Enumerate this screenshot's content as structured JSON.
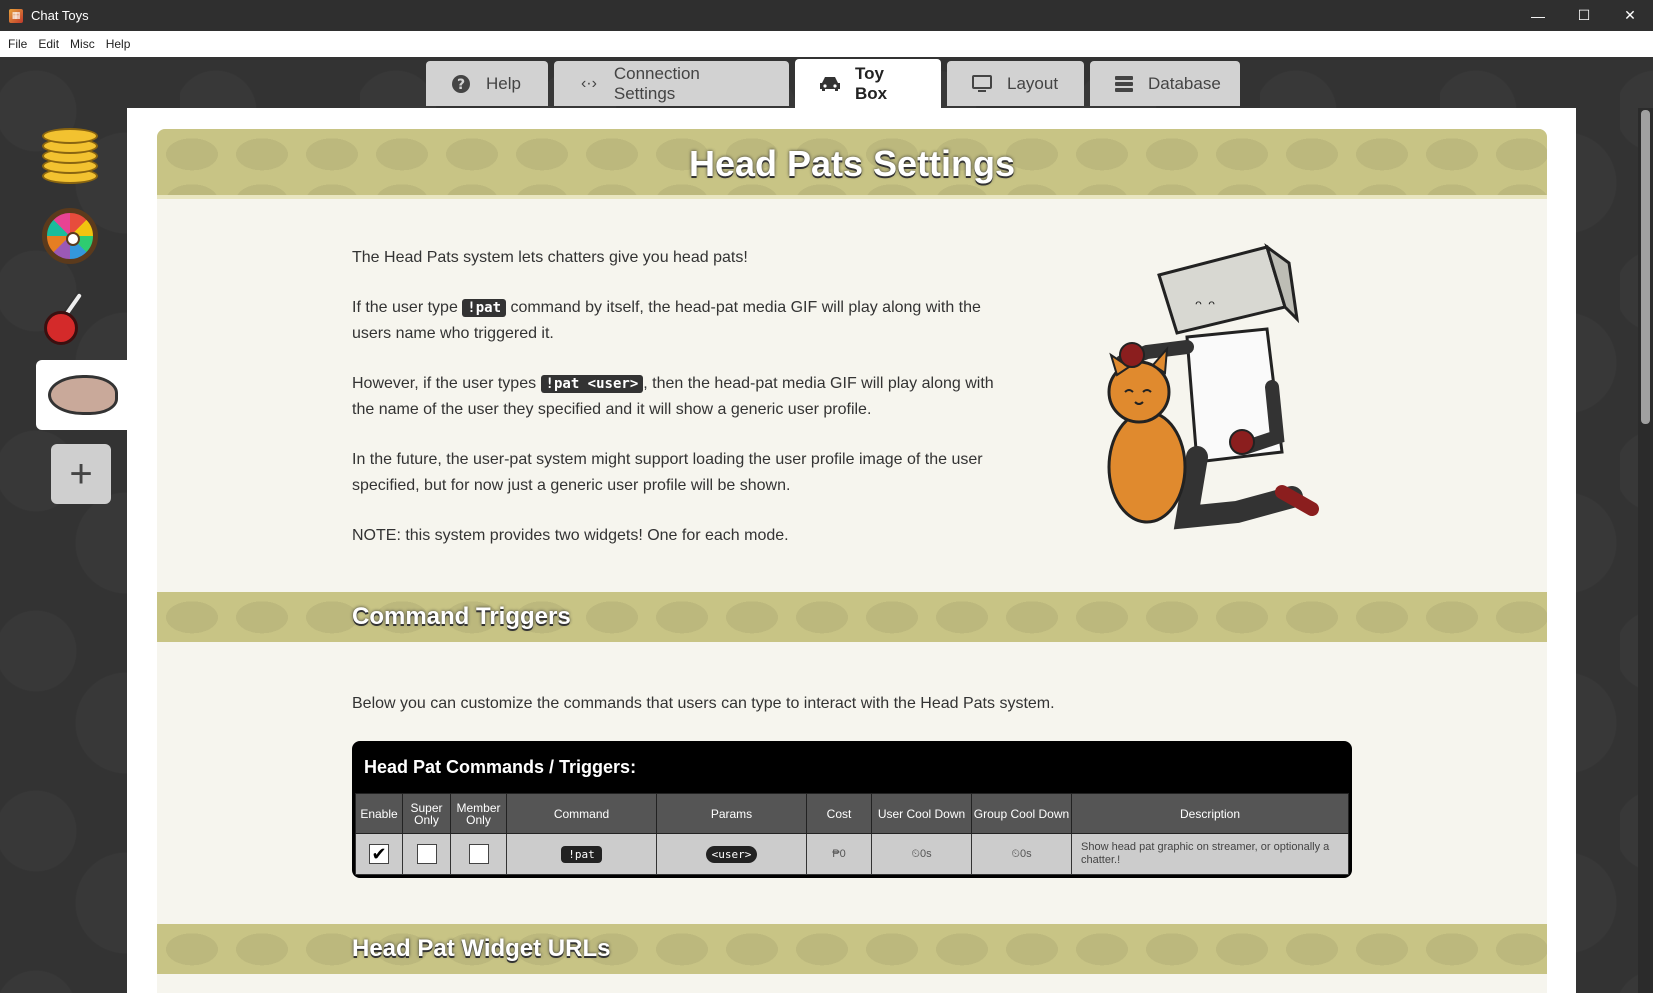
{
  "window": {
    "title": "Chat Toys",
    "minimize": "—",
    "maximize": "☐",
    "close": "✕"
  },
  "menu": [
    "File",
    "Edit",
    "Misc",
    "Help"
  ],
  "tabs": [
    {
      "label": "Help",
      "icon": "?"
    },
    {
      "label": "Connection Settings",
      "icon": "‹·›"
    },
    {
      "label": "Toy Box",
      "icon": "🚗"
    },
    {
      "label": "Layout",
      "icon": "▭"
    },
    {
      "label": "Database",
      "icon": "≡"
    }
  ],
  "sidebar": {
    "add_label": "+"
  },
  "page": {
    "title": "Head Pats Settings",
    "intro": {
      "p1": "The Head Pats system lets chatters give you head pats!",
      "p2_a": "If the user type ",
      "p2_code": "!pat",
      "p2_b": " command by itself, the head-pat media GIF will play along with the users name who triggered it.",
      "p3_a": "However, if the user types ",
      "p3_code": "!pat <user>",
      "p3_b": ", then the head-pat media GIF will play along with the name of the user they specified and it will show a generic user profile.",
      "p4": "In the future, the user-pat system might support loading the user profile image of the user specified, but for now just a generic user profile will be shown.",
      "p5": "NOTE: this system provides two widgets! One for each mode."
    },
    "section_commands": "Command Triggers",
    "commands_desc": "Below you can customize the commands that users can type to interact with the Head Pats system.",
    "table": {
      "title": "Head Pat Commands / Triggers:",
      "headers": [
        "Enable",
        "Super Only",
        "Member Only",
        "Command",
        "Params",
        "Cost",
        "User Cool Down",
        "Group Cool Down",
        "Description"
      ],
      "row": {
        "enable": "✔",
        "super_only": "",
        "member_only": "",
        "command": "!pat",
        "params": "<user>",
        "cost": "₱0",
        "user_cd": "⏲0s",
        "group_cd": "⏲0s",
        "description": "Show head pat graphic on streamer, or optionally a chatter.!"
      }
    },
    "section_urls": "Head Pat Widget URLs"
  }
}
